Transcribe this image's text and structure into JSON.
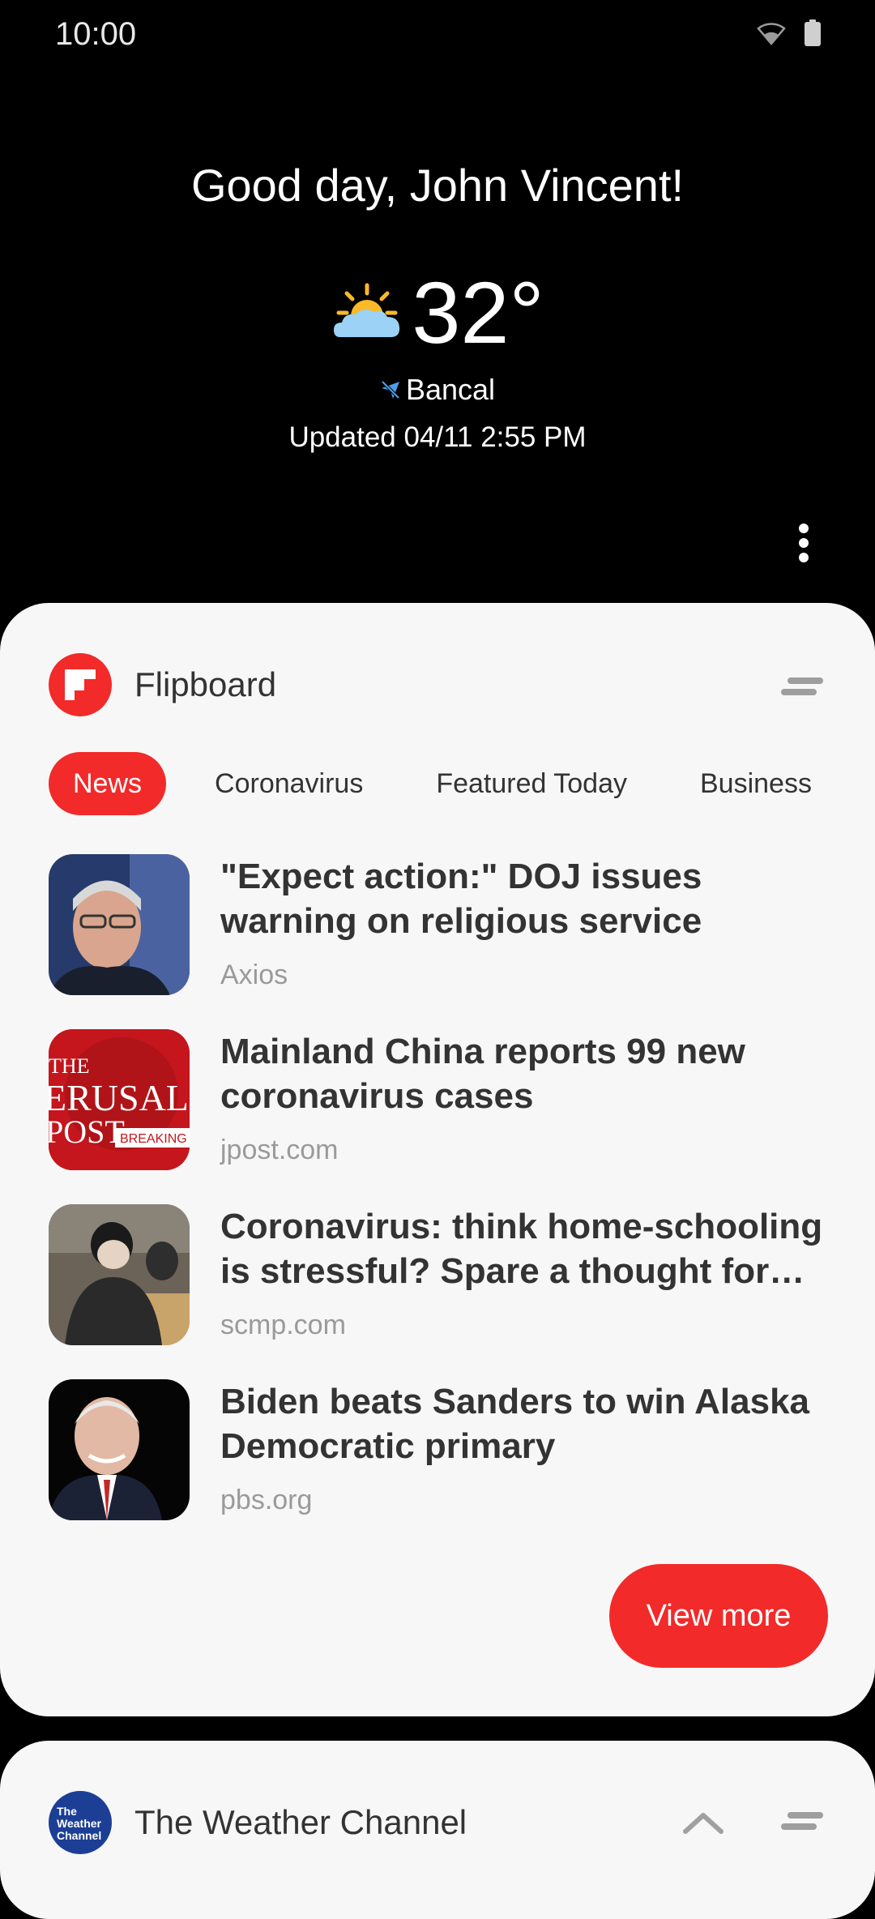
{
  "status_bar": {
    "time": "10:00"
  },
  "header": {
    "greeting": "Good day, John Vincent!",
    "temperature": "32°",
    "location": "Bancal",
    "updated": "Updated 04/11 2:55 PM"
  },
  "flipboard": {
    "title": "Flipboard",
    "tabs": [
      {
        "label": "News",
        "active": true
      },
      {
        "label": "Coronavirus",
        "active": false
      },
      {
        "label": "Featured Today",
        "active": false
      },
      {
        "label": "Business",
        "active": false
      }
    ],
    "articles": [
      {
        "headline": "\"Expect action:\" DOJ issues warning on religious service crackdowns…",
        "source": "Axios"
      },
      {
        "headline": "Mainland China reports 99 new coronavirus cases",
        "source": "jpost.com"
      },
      {
        "headline": "Coronavirus: think home-schooling is stressful? Spare a thought for…",
        "source": "scmp.com"
      },
      {
        "headline": "Biden beats Sanders to win Alaska Democratic primary",
        "source": "pbs.org"
      }
    ],
    "thumbnail_text": {
      "line1": "THE",
      "line2": "ERUSALEM",
      "line3": "POST",
      "badge": "BREAKING"
    },
    "view_more": "View more"
  },
  "weather_channel": {
    "title": "The Weather Channel",
    "icon_text": "The Weather Channel"
  },
  "colors": {
    "accent": "#f22a2a",
    "card_bg": "#f7f7f7",
    "background": "#000000"
  }
}
